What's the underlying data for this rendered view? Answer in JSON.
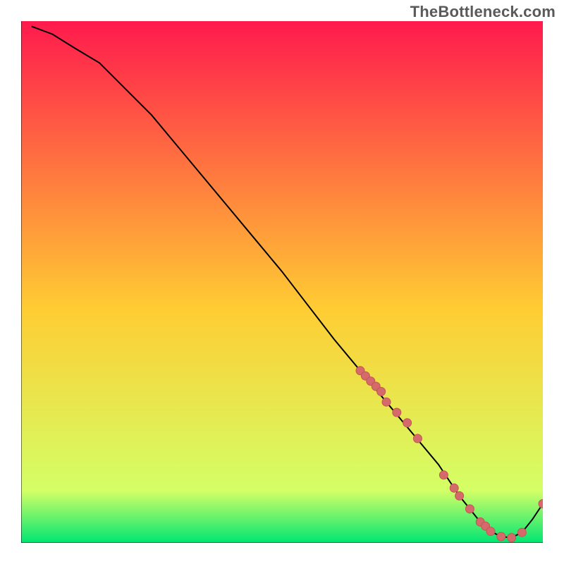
{
  "watermark": "TheBottleneck.com",
  "colors": {
    "gradient_top": "#ff1a4d",
    "gradient_mid": "#ffcc33",
    "gradient_bottom": "#00e673",
    "axis": "#000000",
    "curve": "#000000",
    "marker_fill": "#d46a6a",
    "marker_stroke": "#c45555"
  },
  "chart_data": {
    "type": "line",
    "title": "",
    "xlabel": "",
    "ylabel": "",
    "xlim": [
      0,
      100
    ],
    "ylim": [
      0,
      100
    ],
    "curve": {
      "x": [
        2,
        6,
        10,
        15,
        20,
        25,
        30,
        35,
        40,
        45,
        50,
        55,
        60,
        65,
        70,
        75,
        80,
        82,
        84,
        86,
        88,
        90,
        92,
        94,
        96,
        98,
        100
      ],
      "y": [
        99,
        97.5,
        95,
        92,
        87,
        82,
        76,
        70,
        64,
        58,
        52,
        45.5,
        39,
        33,
        27,
        21,
        15,
        12,
        9,
        6.5,
        4,
        2.2,
        1.2,
        1.0,
        2.0,
        4.5,
        7.5
      ]
    },
    "markers": {
      "x": [
        65,
        66,
        67,
        68,
        69,
        70,
        72,
        74,
        76,
        81,
        83,
        84,
        86,
        88,
        89,
        90,
        92,
        94,
        96,
        100
      ],
      "y": [
        33,
        32,
        31,
        30,
        29,
        27,
        25,
        23,
        20,
        13,
        10.5,
        9,
        6.5,
        4,
        3.2,
        2.2,
        1.2,
        1.0,
        2.0,
        7.5
      ]
    }
  }
}
